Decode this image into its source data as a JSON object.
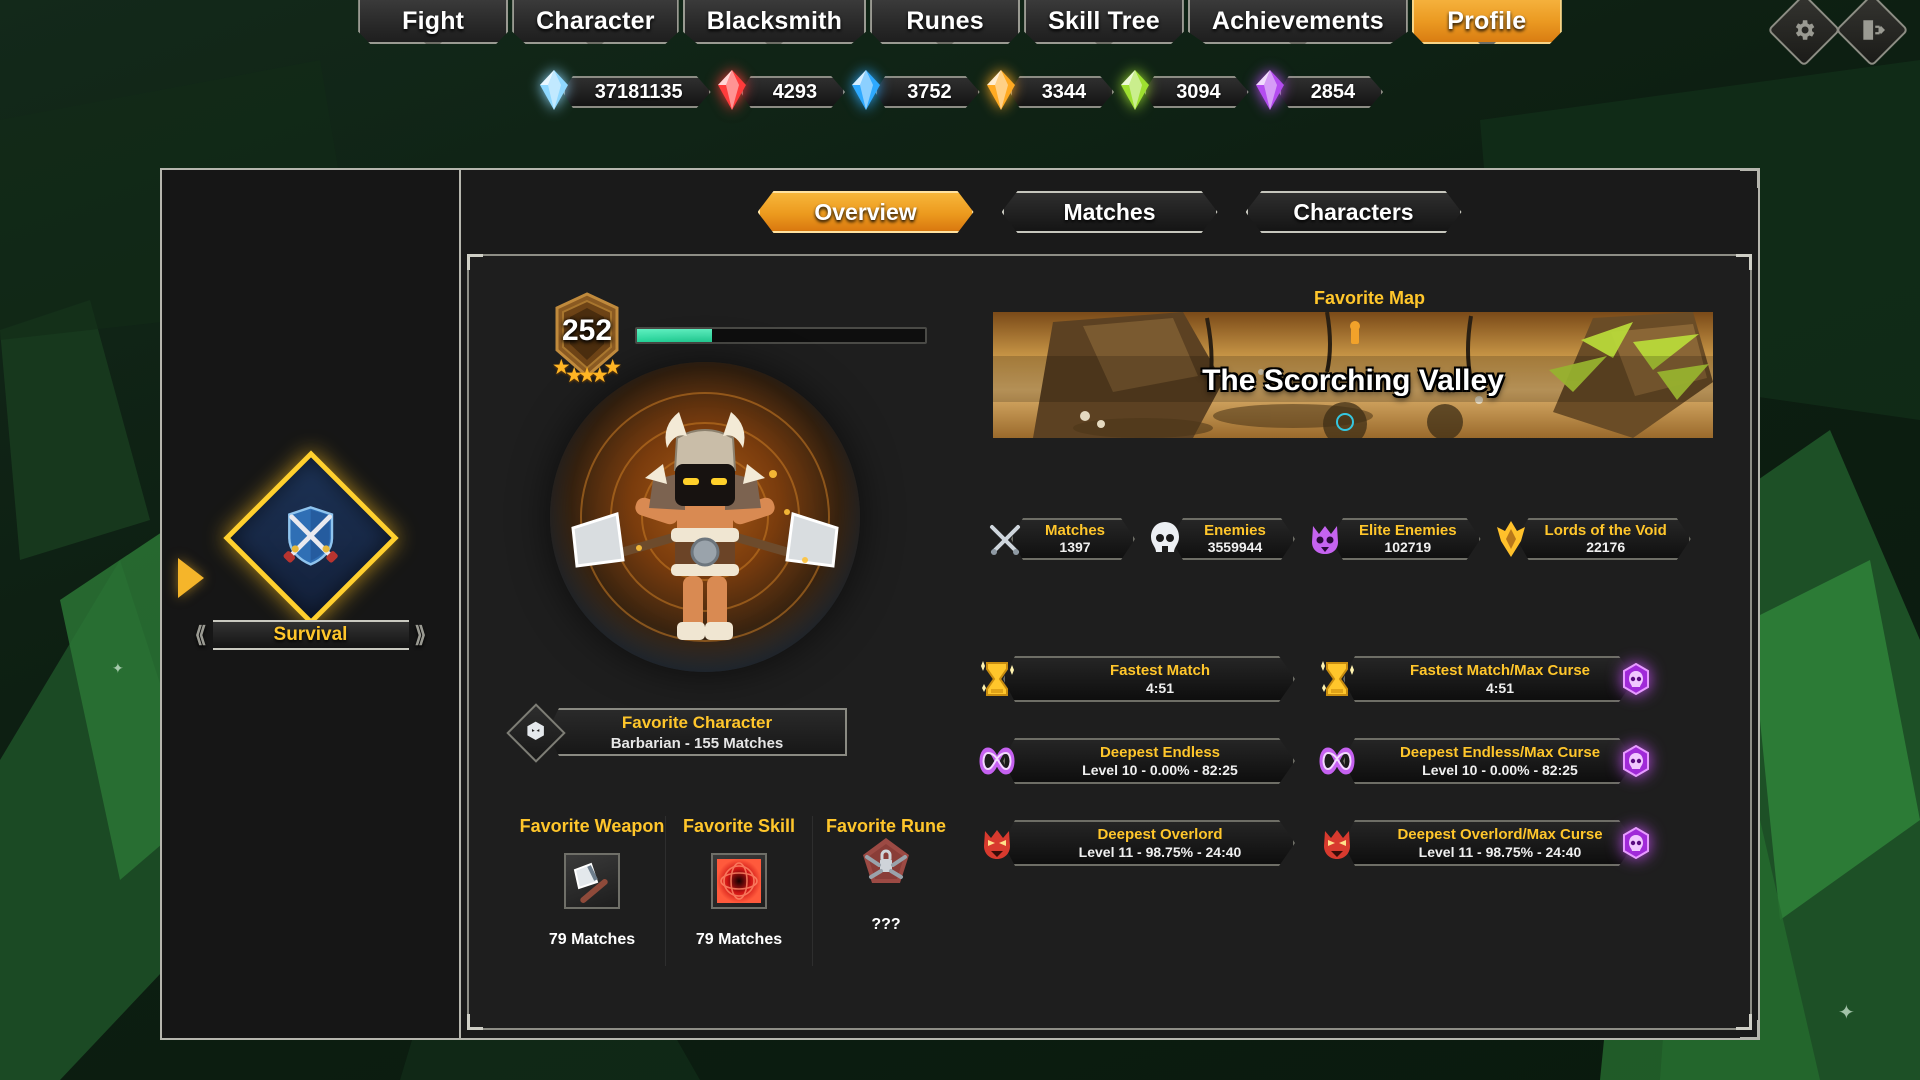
{
  "nav": {
    "tabs": [
      {
        "label": "Fight",
        "active": false
      },
      {
        "label": "Character",
        "active": false
      },
      {
        "label": "Blacksmith",
        "active": false
      },
      {
        "label": "Runes",
        "active": false
      },
      {
        "label": "Skill Tree",
        "active": false
      },
      {
        "label": "Achievements",
        "active": false
      },
      {
        "label": "Profile",
        "active": true
      }
    ],
    "settings_icon": "gear-icon",
    "exit_icon": "exit-door-icon"
  },
  "currencies": [
    {
      "icon": "white-gem-icon",
      "color": "#8fd8ff",
      "value": "37181135"
    },
    {
      "icon": "red-gem-icon",
      "color": "#ff3b3b",
      "value": "4293"
    },
    {
      "icon": "blue-gem-icon",
      "color": "#2ea9ff",
      "value": "3752"
    },
    {
      "icon": "orange-gem-icon",
      "color": "#ffaa22",
      "value": "3344"
    },
    {
      "icon": "green-gem-icon",
      "color": "#9ee030",
      "value": "3094"
    },
    {
      "icon": "purple-gem-icon",
      "color": "#b44cf0",
      "value": "2854"
    }
  ],
  "sidebar": {
    "mode": {
      "name": "Survival",
      "icon": "crossed-swords-shield-icon",
      "selected": true
    }
  },
  "subtabs": [
    {
      "label": "Overview",
      "active": true
    },
    {
      "label": "Matches",
      "active": false
    },
    {
      "label": "Characters",
      "active": false
    }
  ],
  "overview": {
    "level": {
      "value": "252",
      "stars": 5,
      "xp_percent": 26
    },
    "favorite_character": {
      "title": "Favorite Character",
      "value": "Barbarian - 155 Matches",
      "icon": "character-head-icon"
    },
    "favorites": [
      {
        "title": "Favorite Weapon",
        "icon": "axe-icon",
        "count": "79 Matches"
      },
      {
        "title": "Favorite Skill",
        "icon": "red-orb-icon",
        "count": "79 Matches"
      },
      {
        "title": "Favorite Rune",
        "icon": "locked-rune-icon",
        "count": "???"
      }
    ],
    "favorite_map": {
      "label": "Favorite Map",
      "name": "The Scorching Valley"
    },
    "stats": [
      {
        "label": "Matches",
        "value": "1397",
        "icon": "crossed-swords-icon"
      },
      {
        "label": "Enemies",
        "value": "3559944",
        "icon": "skull-icon"
      },
      {
        "label": "Elite Enemies",
        "value": "102719",
        "icon": "purple-demon-icon"
      },
      {
        "label": "Lords of the Void",
        "value": "22176",
        "icon": "gold-void-lord-icon"
      }
    ],
    "records": [
      {
        "left": {
          "label": "Fastest Match",
          "value": "4:51",
          "icon": "hourglass-icon"
        },
        "right": {
          "label": "Fastest Match/Max Curse",
          "value": "4:51",
          "icon": "hourglass-icon",
          "badge": "curse-icon"
        }
      },
      {
        "left": {
          "label": "Deepest Endless",
          "value": "Level 10 - 0.00% - 82:25",
          "icon": "infinity-icon"
        },
        "right": {
          "label": "Deepest Endless/Max Curse",
          "value": "Level 10 - 0.00% - 82:25",
          "icon": "infinity-icon",
          "badge": "curse-icon"
        }
      },
      {
        "left": {
          "label": "Deepest Overlord",
          "value": "Level 11 - 98.75% - 24:40",
          "icon": "red-overlord-icon"
        },
        "right": {
          "label": "Deepest Overlord/Max Curse",
          "value": "Level 11 - 98.75% - 24:40",
          "icon": "red-overlord-icon",
          "badge": "curse-icon"
        }
      }
    ]
  },
  "theme": {
    "accent_gold": "#ffc62b",
    "active_tab": "#eb9a22",
    "xp_green": "#25d79b",
    "frame": "#b6b6ae"
  }
}
